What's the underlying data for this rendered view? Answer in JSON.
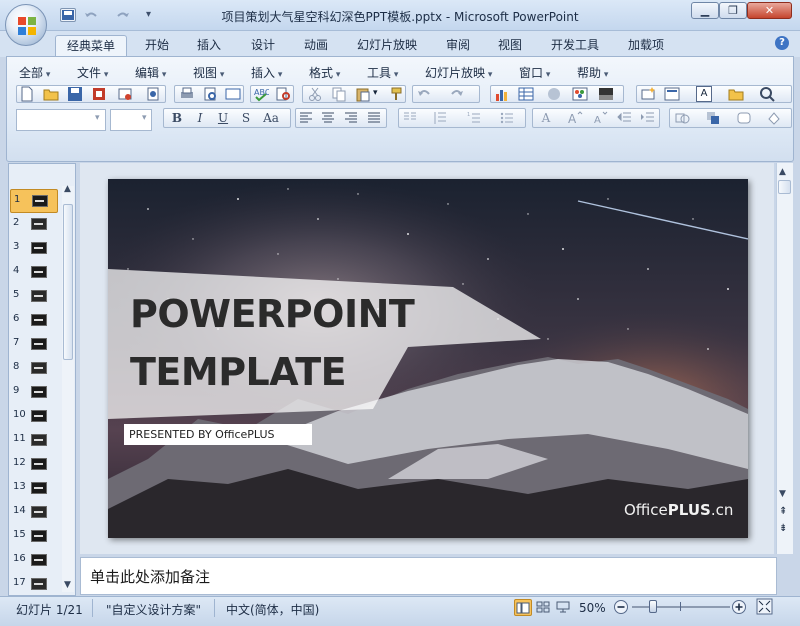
{
  "window": {
    "title": "项目策划大气星空科幻深色PPT模板.pptx - Microsoft PowerPoint",
    "controls": [
      "▁",
      "❐",
      "✕"
    ]
  },
  "tabs": [
    "经典菜单",
    "开始",
    "插入",
    "设计",
    "动画",
    "幻灯片放映",
    "审阅",
    "视图",
    "开发工具",
    "加载项"
  ],
  "menus": [
    "全部",
    "文件",
    "编辑",
    "视图",
    "插入",
    "格式",
    "工具",
    "幻灯片放映",
    "窗口",
    "帮助"
  ],
  "toolbar": {
    "font_name": "",
    "font_size": "",
    "format_buttons": [
      "B",
      "I",
      "U",
      "S",
      "Aa"
    ],
    "font_color_letter": "A"
  },
  "thumbnails": [
    "1",
    "2",
    "3",
    "4",
    "5",
    "6",
    "7",
    "8",
    "9",
    "10",
    "11",
    "12",
    "13",
    "14",
    "15",
    "16",
    "17"
  ],
  "slide": {
    "title_line1": "POWERPOINT",
    "title_line2": "TEMPLATE",
    "presenter": "PRESENTED  BY OfficePLUS",
    "brand_prefix": "Office",
    "brand_bold": "PLUS",
    "brand_suffix": ".cn"
  },
  "notes_placeholder": "单击此处添加备注",
  "status": {
    "slide_count": "幻灯片 1/21",
    "theme": "\"自定义设计方案\"",
    "language": "中文(简体，中国)",
    "zoom": "50%"
  },
  "colors": {
    "accent_blue": "#3e74c4",
    "slide_selected": "#f6c25b"
  },
  "icons": [
    "office-logo-icon",
    "save-icon",
    "undo-icon",
    "redo-icon",
    "help-icon",
    "new-icon",
    "open-icon",
    "print-icon",
    "cut-icon",
    "copy-icon",
    "paste-icon",
    "chart-icon",
    "zoom-icon",
    "normal-view-icon",
    "sorter-view-icon",
    "slideshow-icon",
    "zoom-out-icon",
    "zoom-in-icon",
    "fit-window-icon"
  ]
}
